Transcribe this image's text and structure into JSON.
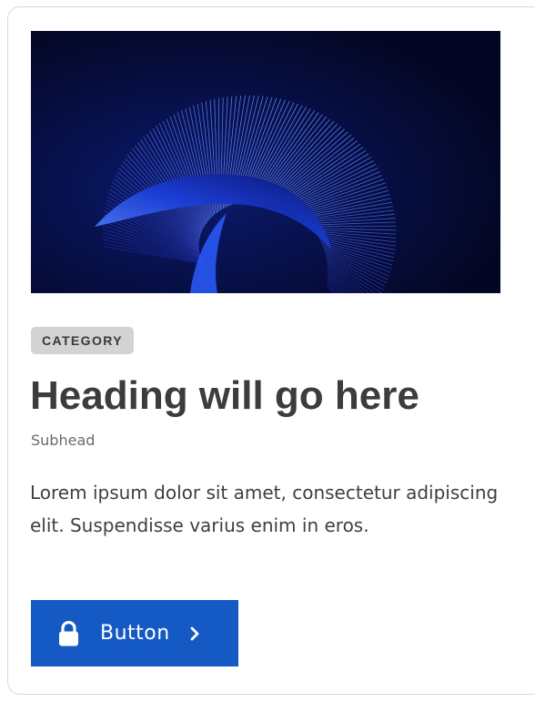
{
  "card": {
    "image": {
      "alt_icon": "abstract-blue-swirl-image",
      "colors": {
        "background": "#030622",
        "swirl_dark": "#0a1a8c",
        "swirl_mid": "#1b3fe0",
        "swirl_light": "#4a7dff"
      }
    },
    "category": "CATEGORY",
    "heading": "Heading will go here",
    "subhead": "Subhead",
    "body": "Lorem ipsum dolor sit amet, consectetur adipiscing elit. Suspendisse varius enim in eros.",
    "button": {
      "label": "Button",
      "leading_icon": "lock-icon",
      "trailing_icon": "chevron-right-icon",
      "color": "#1559c5"
    }
  }
}
